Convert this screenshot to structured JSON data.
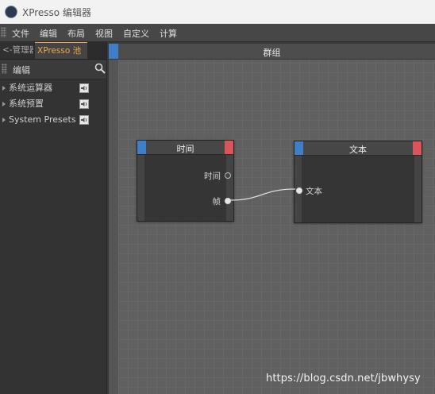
{
  "window": {
    "title": "XPresso 编辑器"
  },
  "menu": [
    "文件",
    "编辑",
    "布局",
    "视图",
    "自定义",
    "计算"
  ],
  "left_panel": {
    "tabs": [
      "<-管理器",
      "XPresso 池"
    ],
    "active_tab": "XPresso 池",
    "header_label": "编辑",
    "tree": [
      {
        "label": "系统运算器",
        "icon": "speaker-icon"
      },
      {
        "label": "系统预置",
        "icon": "speaker-icon"
      },
      {
        "label": "System Presets",
        "icon": "speaker-icon"
      }
    ]
  },
  "editor": {
    "group_title": "群组",
    "nodes": [
      {
        "title": "时间",
        "ports": [
          {
            "label": "时间",
            "connected": false
          },
          {
            "label": "帧",
            "connected": true
          }
        ]
      },
      {
        "title": "文本",
        "ports": [
          {
            "label": "文本",
            "connected": true
          }
        ]
      }
    ]
  },
  "watermark": "https://blog.csdn.net/jbwhysy",
  "colors": {
    "accent_orange": "#f0a548",
    "node_blue": "#3f7fc7",
    "node_red": "#d9555a",
    "grid_bg": "#606060"
  }
}
